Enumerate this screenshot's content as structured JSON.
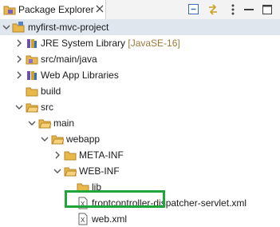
{
  "view": {
    "tab_label": "Package Explorer",
    "icons": [
      "package-explorer-icon",
      "close-icon",
      "collapse-all-icon",
      "link-with-editor-icon",
      "view-menu-icon"
    ]
  },
  "tree": {
    "rows": [
      {
        "name": "project-myfirst-mvc-project",
        "label": "myfirst-mvc-project",
        "expanded": true,
        "icon": "project-icon",
        "selected": true
      },
      {
        "name": "jre-system-library",
        "label": "JRE System Library",
        "decoration": "[JavaSE-16]",
        "expanded": false,
        "icon": "library-icon"
      },
      {
        "name": "src-main-java",
        "label": "src/main/java",
        "expanded": false,
        "icon": "source-folder-icon"
      },
      {
        "name": "web-app-libraries",
        "label": "Web App Libraries",
        "expanded": false,
        "icon": "library-icon"
      },
      {
        "name": "build-folder",
        "label": "build",
        "icon": "folder-icon"
      },
      {
        "name": "src-folder",
        "label": "src",
        "expanded": true,
        "icon": "folder-icon"
      },
      {
        "name": "main-folder",
        "label": "main",
        "expanded": true,
        "icon": "folder-icon"
      },
      {
        "name": "webapp-folder",
        "label": "webapp",
        "expanded": true,
        "icon": "folder-icon"
      },
      {
        "name": "meta-inf-folder",
        "label": "META-INF",
        "expanded": false,
        "icon": "folder-icon"
      },
      {
        "name": "web-inf-folder",
        "label": "WEB-INF",
        "expanded": true,
        "icon": "folder-icon"
      },
      {
        "name": "lib-folder",
        "label": "lib",
        "icon": "folder-icon"
      },
      {
        "name": "frontcontroller-dispatcher-servlet-xml",
        "label": "frontcontroller-dispatcher-servlet.xml",
        "icon": "xml-file-icon"
      },
      {
        "name": "web-xml",
        "label": "web.xml",
        "icon": "xml-file-icon",
        "highlighted": true
      }
    ]
  },
  "colors": {
    "highlight_border": "#1fa53a",
    "selection": "#dfe6ee",
    "folder": "#e8b84a"
  }
}
